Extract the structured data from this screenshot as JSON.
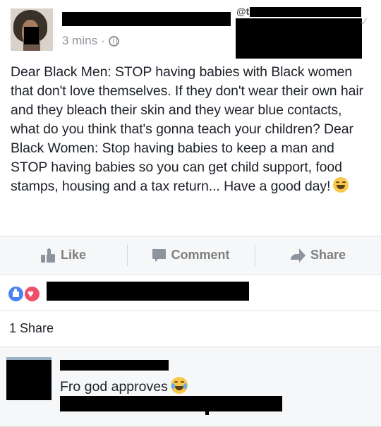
{
  "post": {
    "author_handle": "@t",
    "timestamp": "3 mins",
    "separator": "·",
    "privacy_icon": "globe-icon",
    "text": "Dear Black Men: STOP having babies with Black women that don't love themselves. If they don't wear their own hair and they bleach their skin and they wear blue contacts, what do you think that's gonna teach your children? Dear Black Women: Stop having babies to keep a man and STOP having babies so you can get child support, food stamps, housing and a tax return... Have a good day!",
    "text_emoji": "grinning-squinting-face-icon",
    "menu_icon": "chevron-down-icon"
  },
  "actions": {
    "like_label": "Like",
    "comment_label": "Comment",
    "share_label": "Share"
  },
  "reactions": {
    "icons": [
      "like-reaction-icon",
      "love-reaction-icon"
    ]
  },
  "shares": {
    "label": "1 Share"
  },
  "comment": {
    "text": "Fro god approves",
    "emoji": "tears-of-joy-face-icon"
  },
  "colors": {
    "like_reaction": "#4a83f0",
    "love_reaction": "#ed5167",
    "action_text": "#7f7f7f",
    "band_background": "#f6f7f9"
  }
}
